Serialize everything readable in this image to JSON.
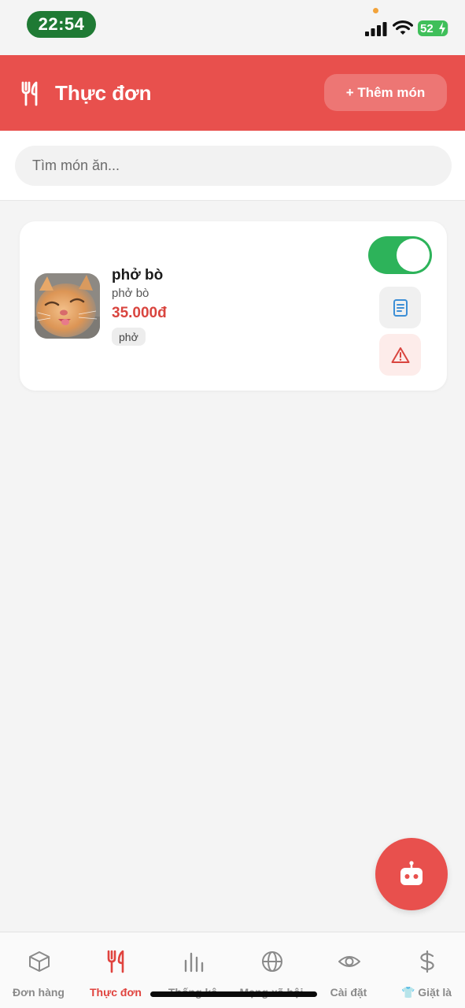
{
  "status_bar": {
    "time": "22:54",
    "battery": "52"
  },
  "header": {
    "title": "Thực đơn",
    "add_button_label": "+ Thêm món",
    "icon": "fork-knife-icon"
  },
  "search": {
    "placeholder": "Tìm món ăn...",
    "value": ""
  },
  "menu_items": [
    {
      "name": "phở bò",
      "description": "phở bò",
      "price": "35.000đ",
      "tag": "phở",
      "available": true,
      "thumbnail": "cat-photo"
    }
  ],
  "fab": {
    "icon": "robot-icon"
  },
  "bottom_nav": {
    "items": [
      {
        "label": "Đơn hàng",
        "icon": "box-icon",
        "active": false
      },
      {
        "label": "Thực đơn",
        "icon": "fork-knife-icon",
        "active": true
      },
      {
        "label": "Thống kê",
        "icon": "bar-chart-icon",
        "active": false
      },
      {
        "label": "Mạng xã hội",
        "icon": "globe-icon",
        "active": false
      },
      {
        "label": "Cài đặt",
        "icon": "eye-icon",
        "active": false
      },
      {
        "label": "👕 Giặt là",
        "icon": "dollar-icon",
        "active": false
      }
    ]
  },
  "colors": {
    "brand": "#e8504d",
    "toggle_on": "#2db35a",
    "price": "#d9453f",
    "time_pill": "#1f7a34"
  }
}
